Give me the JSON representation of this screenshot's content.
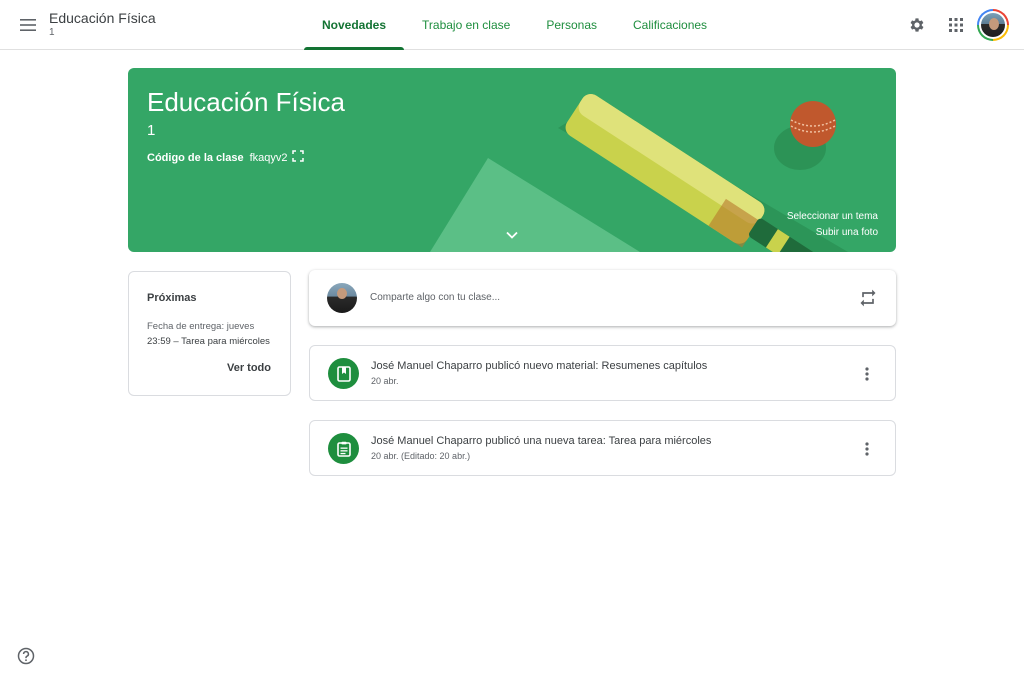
{
  "header": {
    "class_name": "Educación Física",
    "class_section": "1",
    "tabs": [
      {
        "label": "Novedades",
        "active": true
      },
      {
        "label": "Trabajo en clase",
        "active": false
      },
      {
        "label": "Personas",
        "active": false
      },
      {
        "label": "Calificaciones",
        "active": false
      }
    ],
    "icons": [
      "menu-icon",
      "gear-icon",
      "apps-grid-icon",
      "account-avatar"
    ]
  },
  "banner": {
    "title": "Educación Física",
    "section": "1",
    "code_label": "Código de la clase",
    "code_value": "fkaqyv2",
    "select_theme": "Seleccionar un tema",
    "upload_photo": "Subir una foto",
    "color": "#34a666"
  },
  "upcoming": {
    "title": "Próximas",
    "due": "Fecha de entrega: jueves",
    "task": "23:59 – Tarea para miércoles",
    "view_all": "Ver todo"
  },
  "share": {
    "placeholder": "Comparte algo con tu clase..."
  },
  "stream": [
    {
      "icon": "material-icon",
      "text": "José Manuel Chaparro publicó nuevo material: Resumenes capítulos",
      "date": "20 abr."
    },
    {
      "icon": "assignment-icon",
      "text": "José Manuel Chaparro publicó una nueva tarea: Tarea para miércoles",
      "date": "20 abr. (Editado: 20 abr.)"
    }
  ],
  "colors": {
    "accent": "#1e8e3e",
    "active_tab": "#137333",
    "text": "#3c4043",
    "secondary_text": "#5f6368"
  }
}
